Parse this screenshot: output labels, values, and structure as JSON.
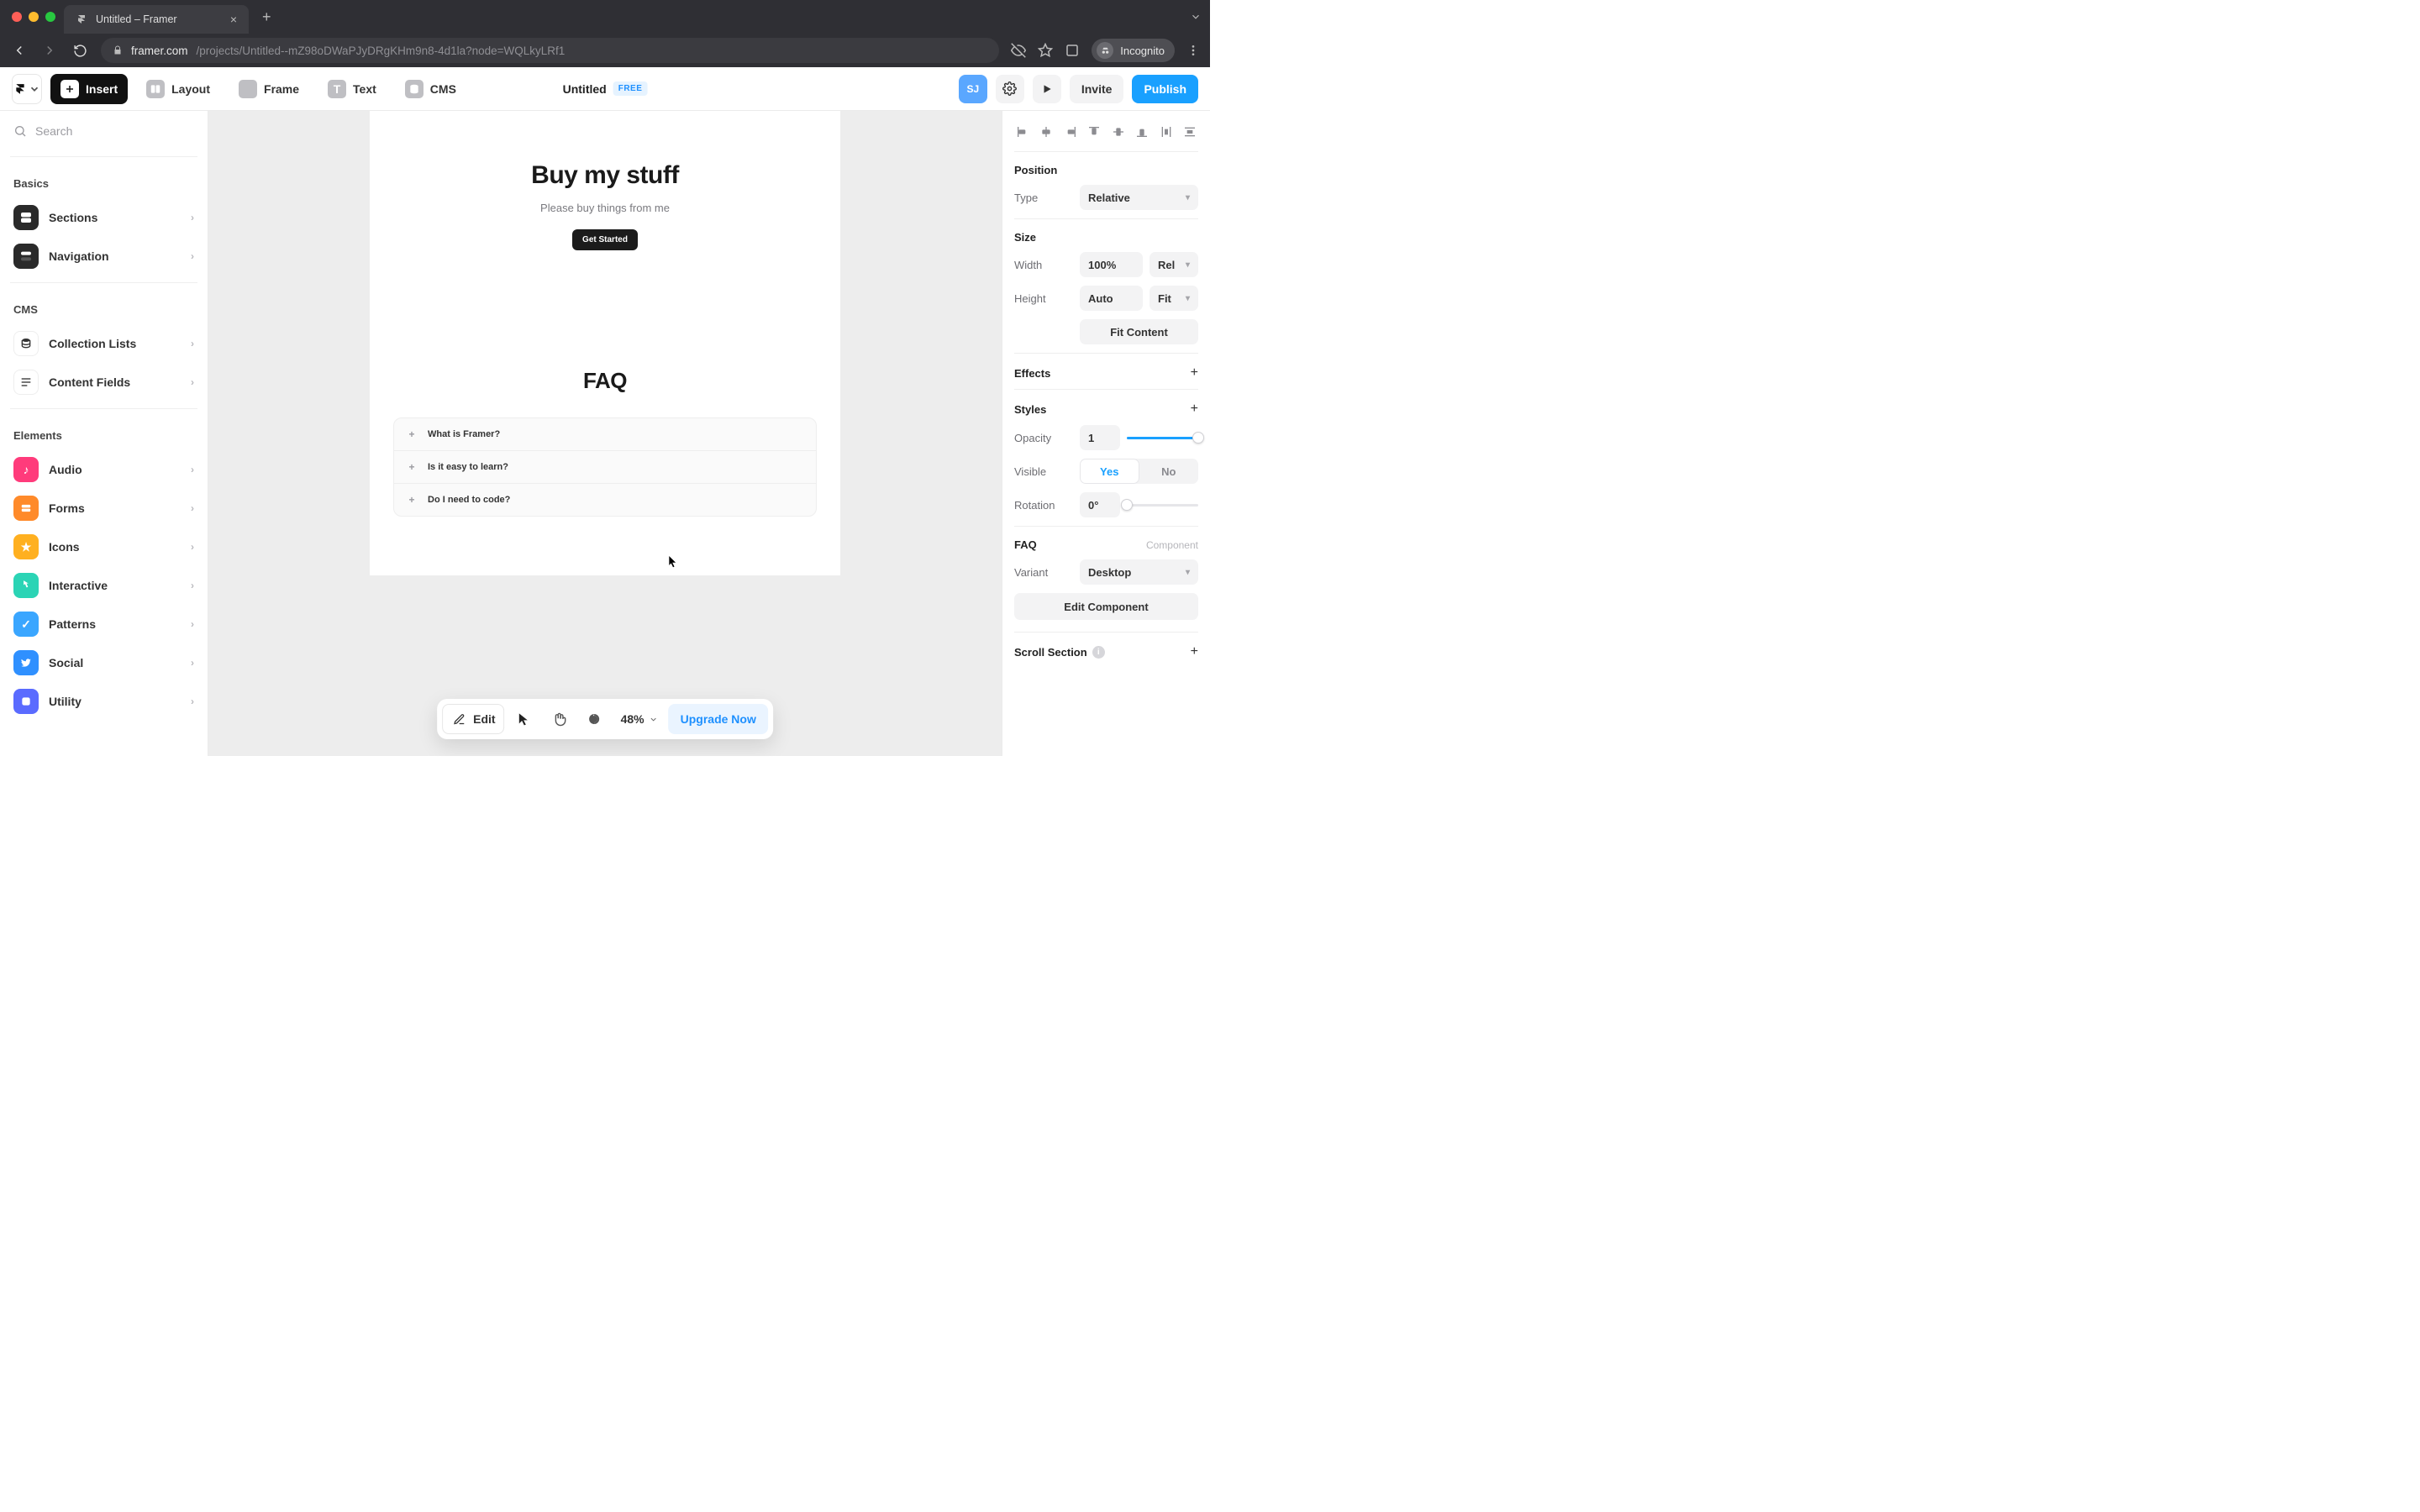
{
  "chrome": {
    "tab_title": "Untitled – Framer",
    "url_host": "framer.com",
    "url_path": "/projects/Untitled--mZ98oDWaPJyDRgKHm9n8-4d1la?node=WQLkyLRf1",
    "incognito_label": "Incognito"
  },
  "toolbar": {
    "insert": "Insert",
    "layout": "Layout",
    "frame": "Frame",
    "text": "Text",
    "cms": "CMS",
    "doc_title": "Untitled",
    "badge": "FREE",
    "avatar": "SJ",
    "invite": "Invite",
    "publish": "Publish"
  },
  "left": {
    "search_placeholder": "Search",
    "groups": [
      {
        "title": "Basics",
        "items": [
          "Sections",
          "Navigation"
        ]
      },
      {
        "title": "CMS",
        "items": [
          "Collection Lists",
          "Content Fields"
        ]
      },
      {
        "title": "Elements",
        "items": [
          "Audio",
          "Forms",
          "Icons",
          "Interactive",
          "Patterns",
          "Social",
          "Utility"
        ]
      }
    ]
  },
  "canvas": {
    "hero_title": "Buy my stuff",
    "hero_sub": "Please buy things from me",
    "hero_cta": "Get Started",
    "faq_title": "FAQ",
    "faq_items": [
      "What is Framer?",
      "Is it easy to learn?",
      "Do I need to code?"
    ]
  },
  "bottom": {
    "edit": "Edit",
    "zoom": "48%",
    "upgrade": "Upgrade Now"
  },
  "inspector": {
    "position_title": "Position",
    "type_label": "Type",
    "type_value": "Relative",
    "size_title": "Size",
    "width_label": "Width",
    "width_value": "100%",
    "width_unit": "Rel",
    "height_label": "Height",
    "height_value": "Auto",
    "height_unit": "Fit",
    "fit_content": "Fit Content",
    "effects_title": "Effects",
    "styles_title": "Styles",
    "opacity_label": "Opacity",
    "opacity_value": "1",
    "visible_label": "Visible",
    "visible_yes": "Yes",
    "visible_no": "No",
    "rotation_label": "Rotation",
    "rotation_value": "0°",
    "component_name": "FAQ",
    "component_tag": "Component",
    "variant_label": "Variant",
    "variant_value": "Desktop",
    "edit_component": "Edit Component",
    "scroll_section": "Scroll Section"
  }
}
